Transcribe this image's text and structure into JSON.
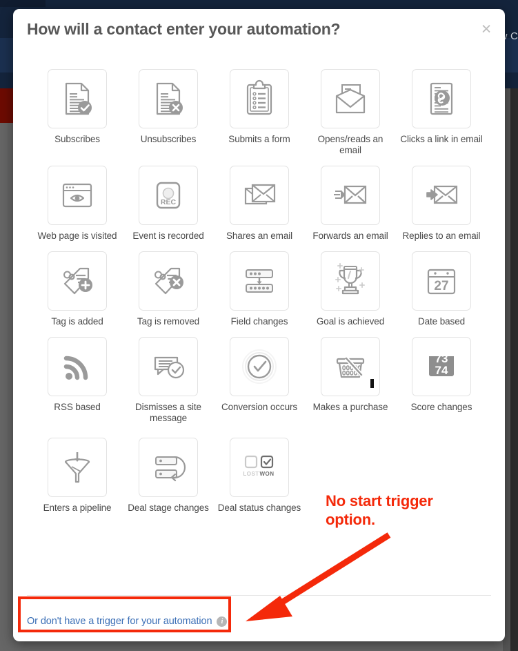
{
  "background": {
    "nav_text": "w C",
    "topbar_color": "#14243c",
    "body_color": "#666666",
    "accent_red_block": "#6d0b02"
  },
  "modal": {
    "title": "How will a contact enter your automation?",
    "close_label": "×",
    "close_icon": "close-icon"
  },
  "triggers": [
    {
      "label": "Subscribes",
      "icon": "document-check-icon"
    },
    {
      "label": "Unsubscribes",
      "icon": "document-x-icon"
    },
    {
      "label": "Submits a form",
      "icon": "clipboard-form-icon"
    },
    {
      "label": "Opens/reads an email",
      "icon": "open-envelope-icon"
    },
    {
      "label": "Clicks a link in email",
      "icon": "document-link-icon"
    },
    {
      "label": "Web page is visited",
      "icon": "browser-eye-icon"
    },
    {
      "label": "Event is recorded",
      "icon": "rec-button-icon"
    },
    {
      "label": "Shares an email",
      "icon": "share-envelopes-icon"
    },
    {
      "label": "Forwards an email",
      "icon": "forward-envelope-icon"
    },
    {
      "label": "Replies to an email",
      "icon": "reply-envelope-icon"
    },
    {
      "label": "Tag is added",
      "icon": "tag-plus-icon"
    },
    {
      "label": "Tag is removed",
      "icon": "tag-x-icon"
    },
    {
      "label": "Field changes",
      "icon": "field-change-icon"
    },
    {
      "label": "Goal is achieved",
      "icon": "trophy-icon"
    },
    {
      "label": "Date based",
      "icon": "calendar-27-icon"
    },
    {
      "label": "RSS based",
      "icon": "rss-icon"
    },
    {
      "label": "Dismisses a site message",
      "icon": "chat-check-icon"
    },
    {
      "label": "Conversion occurs",
      "icon": "conversion-check-icon"
    },
    {
      "label": "Makes a purchase",
      "icon": "shopping-basket-icon"
    },
    {
      "label": "Score changes",
      "icon": "score-73-74-icon"
    },
    {
      "label": "Enters a pipeline",
      "icon": "funnel-icon"
    },
    {
      "label": "Deal stage changes",
      "icon": "deal-stage-icon"
    },
    {
      "label": "Deal status changes",
      "icon": "lost-won-icon"
    }
  ],
  "score_icon": {
    "top_value": "73",
    "bottom_value": "74"
  },
  "calendar_icon": {
    "day": "27"
  },
  "rec_icon": {
    "label": "REC"
  },
  "deal_status_icon": {
    "lost_label": "LOST",
    "won_label": "WON"
  },
  "footer": {
    "no_trigger_link": "Or don't have a trigger for your automation",
    "info_icon": "info-icon",
    "info_glyph": "i"
  },
  "annotation": {
    "text": "No start trigger option.",
    "color": "#f4290a",
    "highlight_box_color": "#f4290a",
    "arrow_icon": "arrow-pointer-icon"
  }
}
